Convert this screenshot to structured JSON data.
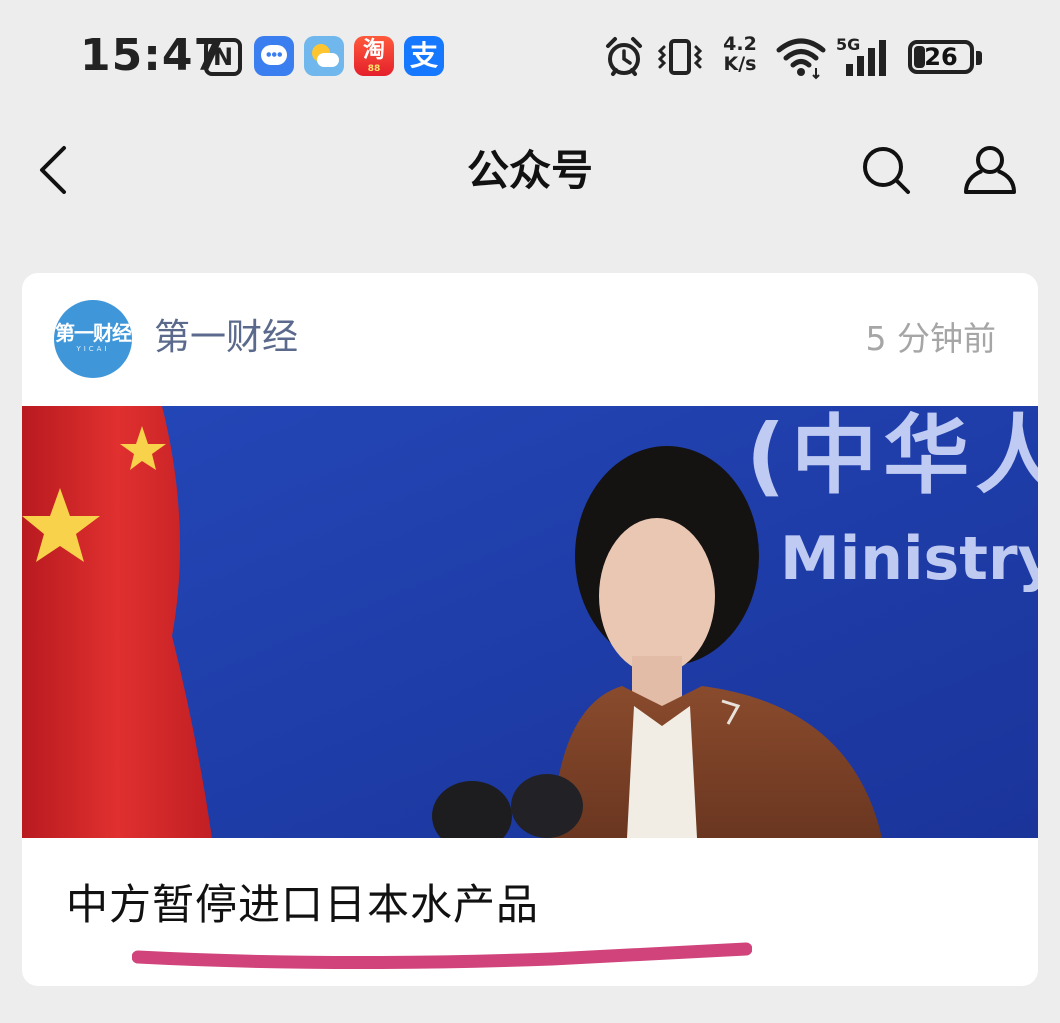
{
  "status_bar": {
    "time": "15:47",
    "nfc_label": "N",
    "notification_icons": [
      "message-icon",
      "weather-icon",
      "taobao-icon",
      "alipay-icon"
    ],
    "taobao_label": "淘",
    "taobao_sub": "88",
    "alipay_label": "支",
    "net_speed_value": "4.2",
    "net_speed_unit": "K/s",
    "signal_label": "5G",
    "battery_percent": 26
  },
  "nav": {
    "title": "公众号",
    "back_icon": "chevron-left-icon",
    "search_icon": "search-icon",
    "profile_icon": "person-icon"
  },
  "post": {
    "account_name": "第一财经",
    "avatar_logo_text": "第一财经",
    "avatar_logo_sub": "YICAI",
    "time_ago": "5 分钟前",
    "image_backdrop_cn": "(中华人",
    "image_backdrop_en": "Ministry",
    "headline": "中方暂停进口日本水产品",
    "annotation_color": "#d0437b"
  },
  "colors": {
    "background": "#ededed",
    "card": "#ffffff",
    "account_name": "#5b6a8c",
    "time_ago": "#a6a6a6",
    "backdrop_blue": "#1d3aa6",
    "flag_red": "#d8242a",
    "flag_star": "#f7d24a"
  }
}
